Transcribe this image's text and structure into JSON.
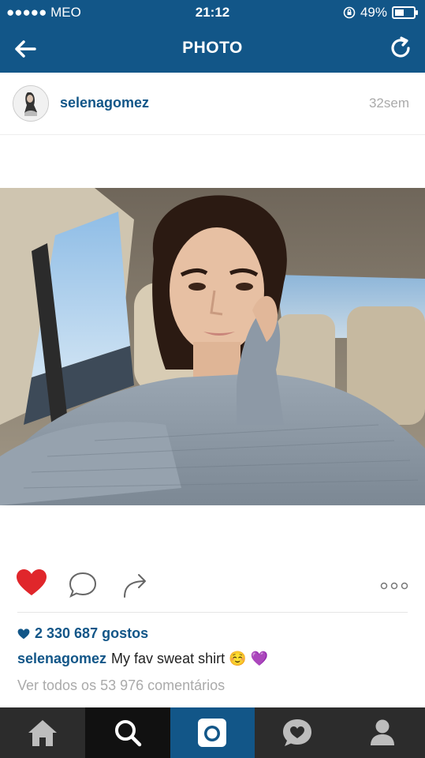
{
  "status_bar": {
    "carrier": "●●●●● MEO",
    "time": "21:12",
    "battery_text": "49%",
    "battery_level": 0.49
  },
  "nav": {
    "title": "PHOTO",
    "back_icon": "arrow-left-icon",
    "refresh_icon": "refresh-icon"
  },
  "post": {
    "username": "selenagomez",
    "time_ago": "32sem",
    "likes_text": "2 330 687 gostos",
    "caption_user": "selenagomez",
    "caption_text": "My fav sweat shirt ☺️ 💜",
    "view_comments": "Ver todos os 53 976 comentários"
  },
  "tabs": [
    {
      "name": "home",
      "icon": "home-icon"
    },
    {
      "name": "search",
      "icon": "search-icon"
    },
    {
      "name": "camera",
      "icon": "camera-icon"
    },
    {
      "name": "activity",
      "icon": "heart-bubble-icon"
    },
    {
      "name": "profile",
      "icon": "profile-icon"
    }
  ],
  "colors": {
    "brand": "#125688",
    "like_red": "#e0262b",
    "tabbar": "#2c2c2c"
  }
}
